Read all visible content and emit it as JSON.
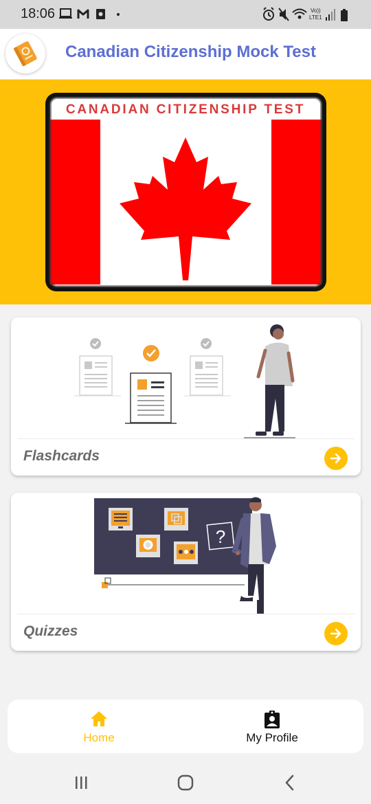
{
  "status_bar": {
    "time": "18:06",
    "network_label": "LTE1",
    "left_icons": [
      "laptop-icon",
      "gmail-icon",
      "app-icon",
      "dot-icon"
    ],
    "right_icons": [
      "alarm-icon",
      "mute-icon",
      "wifi-icon",
      "signal-icon",
      "battery-icon"
    ]
  },
  "header": {
    "title": "Canadian Citizenship Mock Test",
    "logo_icon": "passport-icon"
  },
  "hero": {
    "banner_text": "CANADIAN CITIZENSHIP TEST",
    "flag_icon": "maple-leaf-icon"
  },
  "cards": [
    {
      "label": "Flashcards",
      "illustration": "flashcards-illustration",
      "action_icon": "arrow-right-icon"
    },
    {
      "label": "Quizzes",
      "illustration": "quizzes-illustration",
      "action_icon": "arrow-right-icon"
    }
  ],
  "bottom_nav": [
    {
      "label": "Home",
      "icon": "home-icon",
      "active": true
    },
    {
      "label": "My Profile",
      "icon": "profile-icon",
      "active": false
    }
  ],
  "colors": {
    "accent": "#ffc107",
    "title": "#5d6fd1",
    "flag_red": "#ff0000",
    "status_bar": "#d9d9d9"
  },
  "system_nav": [
    "recent-apps-icon",
    "home-circle-icon",
    "back-icon"
  ]
}
